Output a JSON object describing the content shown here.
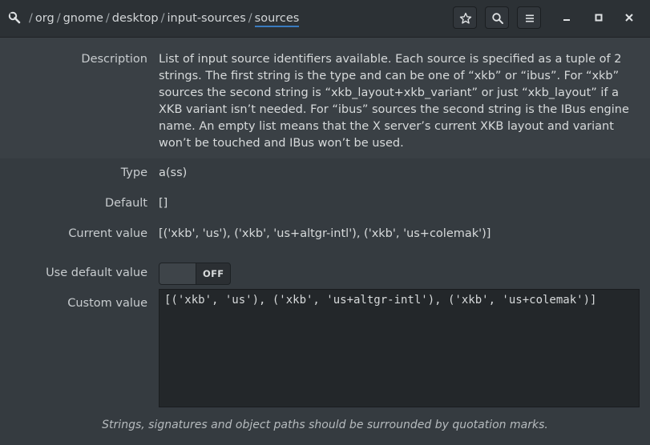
{
  "header": {
    "path_segments": [
      "org",
      "gnome",
      "desktop",
      "input-sources"
    ],
    "separator": "/",
    "current_key": "sources",
    "icons": {
      "app": "dconf-wrench-icon",
      "bookmark": "star-icon",
      "search": "search-icon",
      "menu": "hamburger-menu-icon",
      "minimize": "minimize-icon",
      "maximize": "maximize-icon",
      "close": "close-icon"
    }
  },
  "details": {
    "description_label": "Description",
    "description": "List of input source identifiers available. Each source is specified as a tuple of 2 strings. The first string is the type and can be one of “xkb” or “ibus”. For “xkb” sources the second string is “xkb_layout+xkb_variant” or just “xkb_layout” if a XKB variant isn’t needed. For “ibus” sources the second string is the IBus engine name. An empty list means that the X server’s current XKB layout and variant won’t be touched and IBus won’t be used.",
    "type_label": "Type",
    "type_value": "a(ss)",
    "default_label": "Default",
    "default_value": "[]",
    "current_label": "Current value",
    "current_value": "[('xkb', 'us'), ('xkb', 'us+altgr-intl'), ('xkb', 'us+colemak')]",
    "use_default_label": "Use default value",
    "use_default_state": "OFF",
    "custom_label": "Custom value",
    "custom_value": "[('xkb', 'us'), ('xkb', 'us+altgr-intl'), ('xkb', 'us+colemak')]",
    "footnote": "Strings, signatures and object paths should be surrounded by quotation marks."
  },
  "colors": {
    "background": "#353b40",
    "header": "#2c3135",
    "description_band": "#3a4045",
    "accent": "#3a7bbf",
    "editor_bg": "#23272a"
  }
}
